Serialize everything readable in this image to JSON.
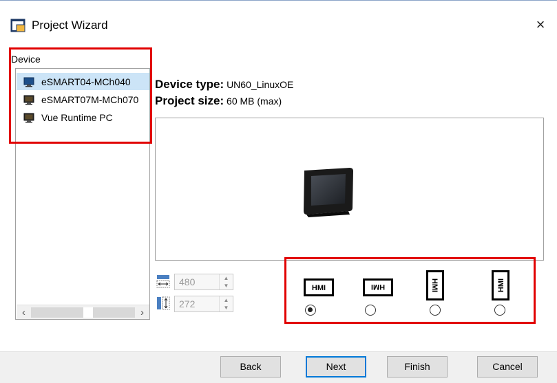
{
  "window": {
    "title": "Project Wizard",
    "close_glyph": "×"
  },
  "device_panel": {
    "label": "Device",
    "items": [
      {
        "label": "eSMART04-MCh040",
        "selected": true
      },
      {
        "label": "eSMART07M-MCh070",
        "selected": false
      },
      {
        "label": "Vue Runtime PC",
        "selected": false
      }
    ]
  },
  "info": {
    "device_type_label": "Device type:",
    "device_type_value": "UN60_LinuxOE",
    "project_size_label": "Project size:",
    "project_size_value": "60 MB (max)"
  },
  "resolution": {
    "width": "480",
    "height": "272"
  },
  "orientation": {
    "options": [
      {
        "icon_text": "HMI",
        "rotation": 0,
        "checked": true
      },
      {
        "icon_text": "HMI",
        "rotation": 180,
        "checked": false
      },
      {
        "icon_text": "HMI",
        "rotation": 90,
        "checked": false
      },
      {
        "icon_text": "HMI",
        "rotation": 270,
        "checked": false
      }
    ]
  },
  "buttons": {
    "back": "Back",
    "next": "Next",
    "finish": "Finish",
    "cancel": "Cancel"
  },
  "colors": {
    "highlight": "#e10000",
    "selection": "#cce4f7",
    "default_button_border": "#0078d7"
  }
}
